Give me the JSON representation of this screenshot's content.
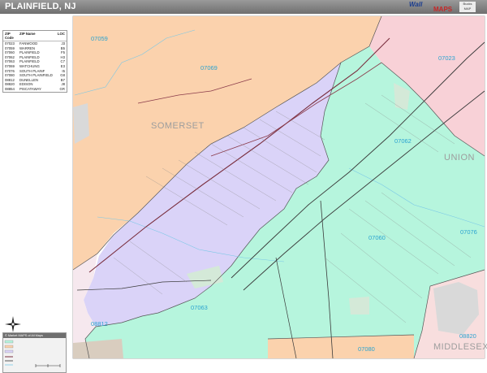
{
  "header": {
    "title": "PLAINFIELD, NJ",
    "brand_top": "Wall",
    "brand_bottom": "MAPS",
    "badge": "Bucks MAP"
  },
  "legend": {
    "headers": [
      "ZIP Code",
      "ZIP Name",
      "LOC"
    ],
    "rows": [
      [
        "07023",
        "FANWOOD",
        "J3"
      ],
      [
        "07059",
        "WARREN",
        "B5"
      ],
      [
        "07060",
        "PLAINFIELD",
        "F5"
      ],
      [
        "07062",
        "PLAINFIELD",
        "H3"
      ],
      [
        "07063",
        "PLAINFIELD",
        "C7"
      ],
      [
        "07069",
        "WATCHUNG",
        "E3"
      ],
      [
        "07076",
        "SOUTH PLAINF",
        "I5"
      ],
      [
        "07080",
        "SOUTH PLAINFIELD",
        "G8"
      ],
      [
        "08812",
        "DUNELLEN",
        "B7"
      ],
      [
        "08820",
        "EDISON",
        "J8"
      ],
      [
        "08854",
        "PISCATAWAY",
        "GR"
      ]
    ]
  },
  "map_legend_title": "© Market MAPS of All Maps",
  "zip_labels": {
    "z07059": "07059",
    "z07069": "07069",
    "z07023": "07023",
    "z07062": "07062",
    "z07060": "07060",
    "z07076": "07076",
    "z07063": "07063",
    "z08812": "08812",
    "z07080": "07080",
    "z08820": "08820"
  },
  "county_labels": {
    "somerset": "SOMERSET",
    "union": "UNION",
    "middlesex": "MIDDLESEX"
  },
  "colors": {
    "orange": "#fbd2ad",
    "purple": "#dad3f8",
    "green": "#b6f5dd",
    "pink": "#f8d1d7",
    "lightpink": "#f8dede",
    "boundary": "#555555",
    "road": "#7a2f3f",
    "water": "#7ac8e6"
  }
}
